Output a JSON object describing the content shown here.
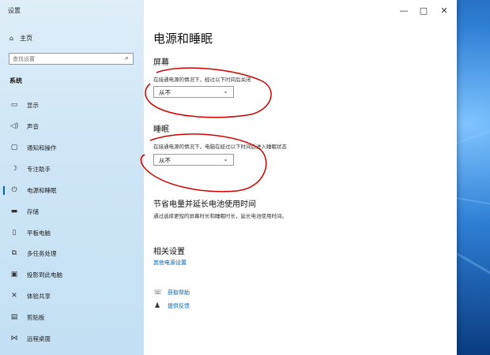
{
  "window": {
    "title": "设置",
    "controls": {
      "minimize": "—",
      "maximize": "□",
      "close": "✕"
    }
  },
  "sidebar": {
    "home_label": "主页",
    "search_placeholder": "查找设置",
    "section_label": "系统",
    "items": [
      {
        "label": "显示",
        "icon": "monitor-icon"
      },
      {
        "label": "声音",
        "icon": "speaker-icon"
      },
      {
        "label": "通知和操作",
        "icon": "notification-icon"
      },
      {
        "label": "专注助手",
        "icon": "moon-icon"
      },
      {
        "label": "电源和睡眠",
        "icon": "power-icon",
        "active": true
      },
      {
        "label": "存储",
        "icon": "storage-icon"
      },
      {
        "label": "平板电脑",
        "icon": "tablet-icon"
      },
      {
        "label": "多任务处理",
        "icon": "multitask-icon"
      },
      {
        "label": "投影到此电脑",
        "icon": "projector-icon"
      },
      {
        "label": "体验共享",
        "icon": "share-icon"
      },
      {
        "label": "剪贴板",
        "icon": "clipboard-icon"
      },
      {
        "label": "远程桌面",
        "icon": "remote-icon"
      }
    ]
  },
  "main": {
    "title": "电源和睡眠",
    "screen": {
      "heading": "屏幕",
      "description": "在接通电源的情况下，经过以下时间后关闭",
      "value": "从不"
    },
    "sleep": {
      "heading": "睡眠",
      "description": "在接通电源的情况下，电脑在经过以下时间后进入睡眠状态",
      "value": "从不"
    },
    "battery": {
      "heading": "节省电量并延长电池使用时间",
      "description": "通过选择更短的屏幕时长和睡眠时长，延长电池使用时间。"
    },
    "related": {
      "heading": "相关设置",
      "link": "其他电源设置"
    },
    "help": {
      "get_help": "获取帮助",
      "feedback": "提供反馈"
    }
  },
  "colors": {
    "accent": "#0063b1",
    "annotation": "#d10000"
  }
}
